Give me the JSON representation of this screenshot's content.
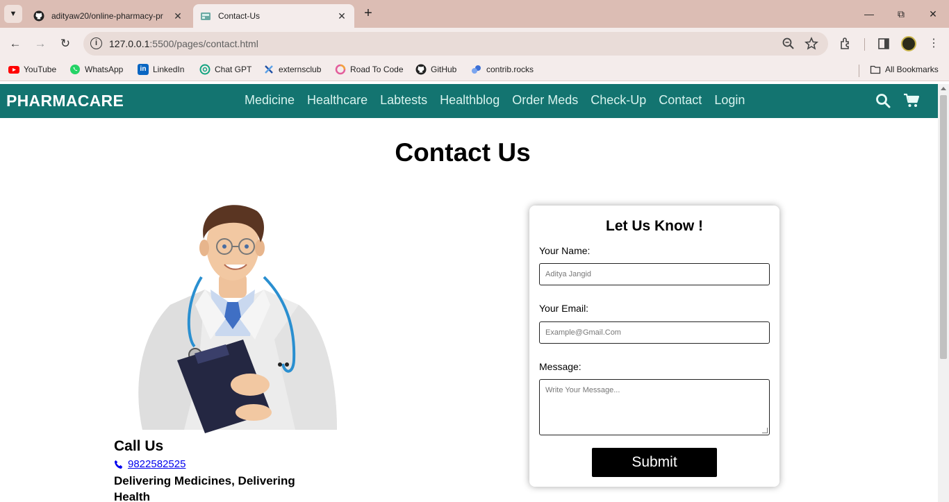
{
  "browser": {
    "tabs": [
      {
        "title": "adityaw20/online-pharmacy-pr",
        "icon": "github-icon",
        "active": false
      },
      {
        "title": "Contact-Us",
        "icon": "site-favicon",
        "active": true
      }
    ],
    "url_host": "127.0.0.1",
    "url_path": ":5500/pages/contact.html",
    "bookmarks": [
      {
        "label": "YouTube",
        "icon": "youtube-icon",
        "color": "#ff0000"
      },
      {
        "label": "WhatsApp",
        "icon": "whatsapp-icon",
        "color": "#25d366"
      },
      {
        "label": "LinkedIn",
        "icon": "linkedin-icon",
        "color": "#0a66c2"
      },
      {
        "label": "Chat GPT",
        "icon": "chatgpt-icon",
        "color": "#10a37f"
      },
      {
        "label": "externsclub",
        "icon": "externsclub-icon",
        "color": "#1e4fa3"
      },
      {
        "label": "Road To Code",
        "icon": "roadtocode-icon",
        "color": "#e35d9b"
      },
      {
        "label": "GitHub",
        "icon": "github-icon",
        "color": "#222222"
      },
      {
        "label": "contrib.rocks",
        "icon": "contrib-icon",
        "color": "#3b6fd6"
      }
    ],
    "all_bookmarks": "All Bookmarks"
  },
  "site": {
    "brand": "PHARMACARE",
    "nav": [
      "Medicine",
      "Healthcare",
      "Labtests",
      "Healthblog",
      "Order Meds",
      "Check-Up",
      "Contact",
      "Login"
    ],
    "accent": "#137470",
    "heading": "Contact Us",
    "call": {
      "title": "Call Us",
      "phone": " 9822582525",
      "tagline": "Delivering Medicines, Delivering Health"
    },
    "form": {
      "title": "Let Us Know !",
      "name_label": "Your Name:",
      "name_placeholder": "Aditya Jangid",
      "email_label": "Your Email:",
      "email_placeholder": "Example@Gmail.Com",
      "message_label": "Message:",
      "message_placeholder": "Write Your Message...",
      "submit": "Submit"
    }
  }
}
